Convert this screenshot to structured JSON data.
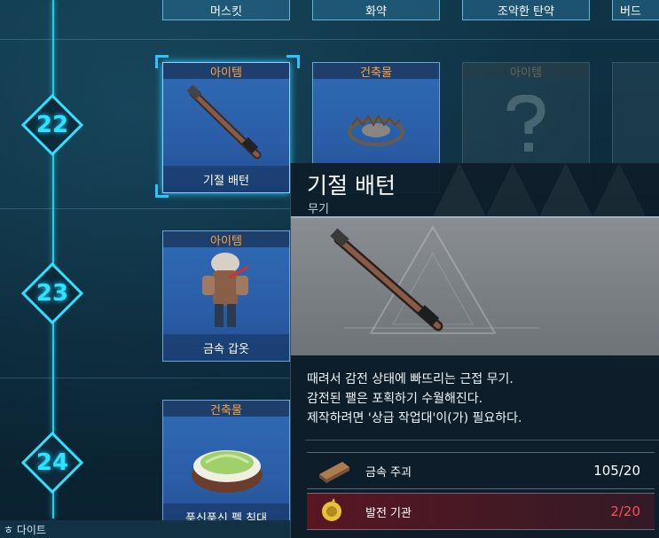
{
  "top_buttons": [
    "머스킷",
    "화약",
    "조악한 탄약",
    "버드"
  ],
  "levels": [
    "22",
    "23",
    "24"
  ],
  "cards": {
    "row22": [
      {
        "tag": "아이템",
        "name": "기절 배턴",
        "selected": true
      },
      {
        "tag": "건축물",
        "name": ""
      },
      {
        "tag": "아이템",
        "name": "",
        "locked": true
      }
    ],
    "row23": [
      {
        "tag": "아이템",
        "name": "금속 갑옷"
      }
    ],
    "row24": [
      {
        "tag": "건축물",
        "name": "푹신푹신 펠 침대"
      }
    ]
  },
  "tooltip": {
    "title": "기절 배턴",
    "subtitle": "무기",
    "description": [
      "때려서 감전 상태에 빠뜨리는 근접 무기.",
      "감전된 팰은 포획하기 수월해진다.",
      "제작하려면 '상급 작업대'이(가) 필요하다."
    ],
    "materials": [
      {
        "name": "금속 주괴",
        "count": "105/20",
        "sufficient": true
      },
      {
        "name": "발전 기관",
        "count": "2/20",
        "sufficient": false
      }
    ]
  },
  "bottom_label": "ㅎ 다이트",
  "colors": {
    "accent": "#1bd0f0",
    "tag_text": "#ffa43a",
    "insufficient": "#ff4d55"
  }
}
